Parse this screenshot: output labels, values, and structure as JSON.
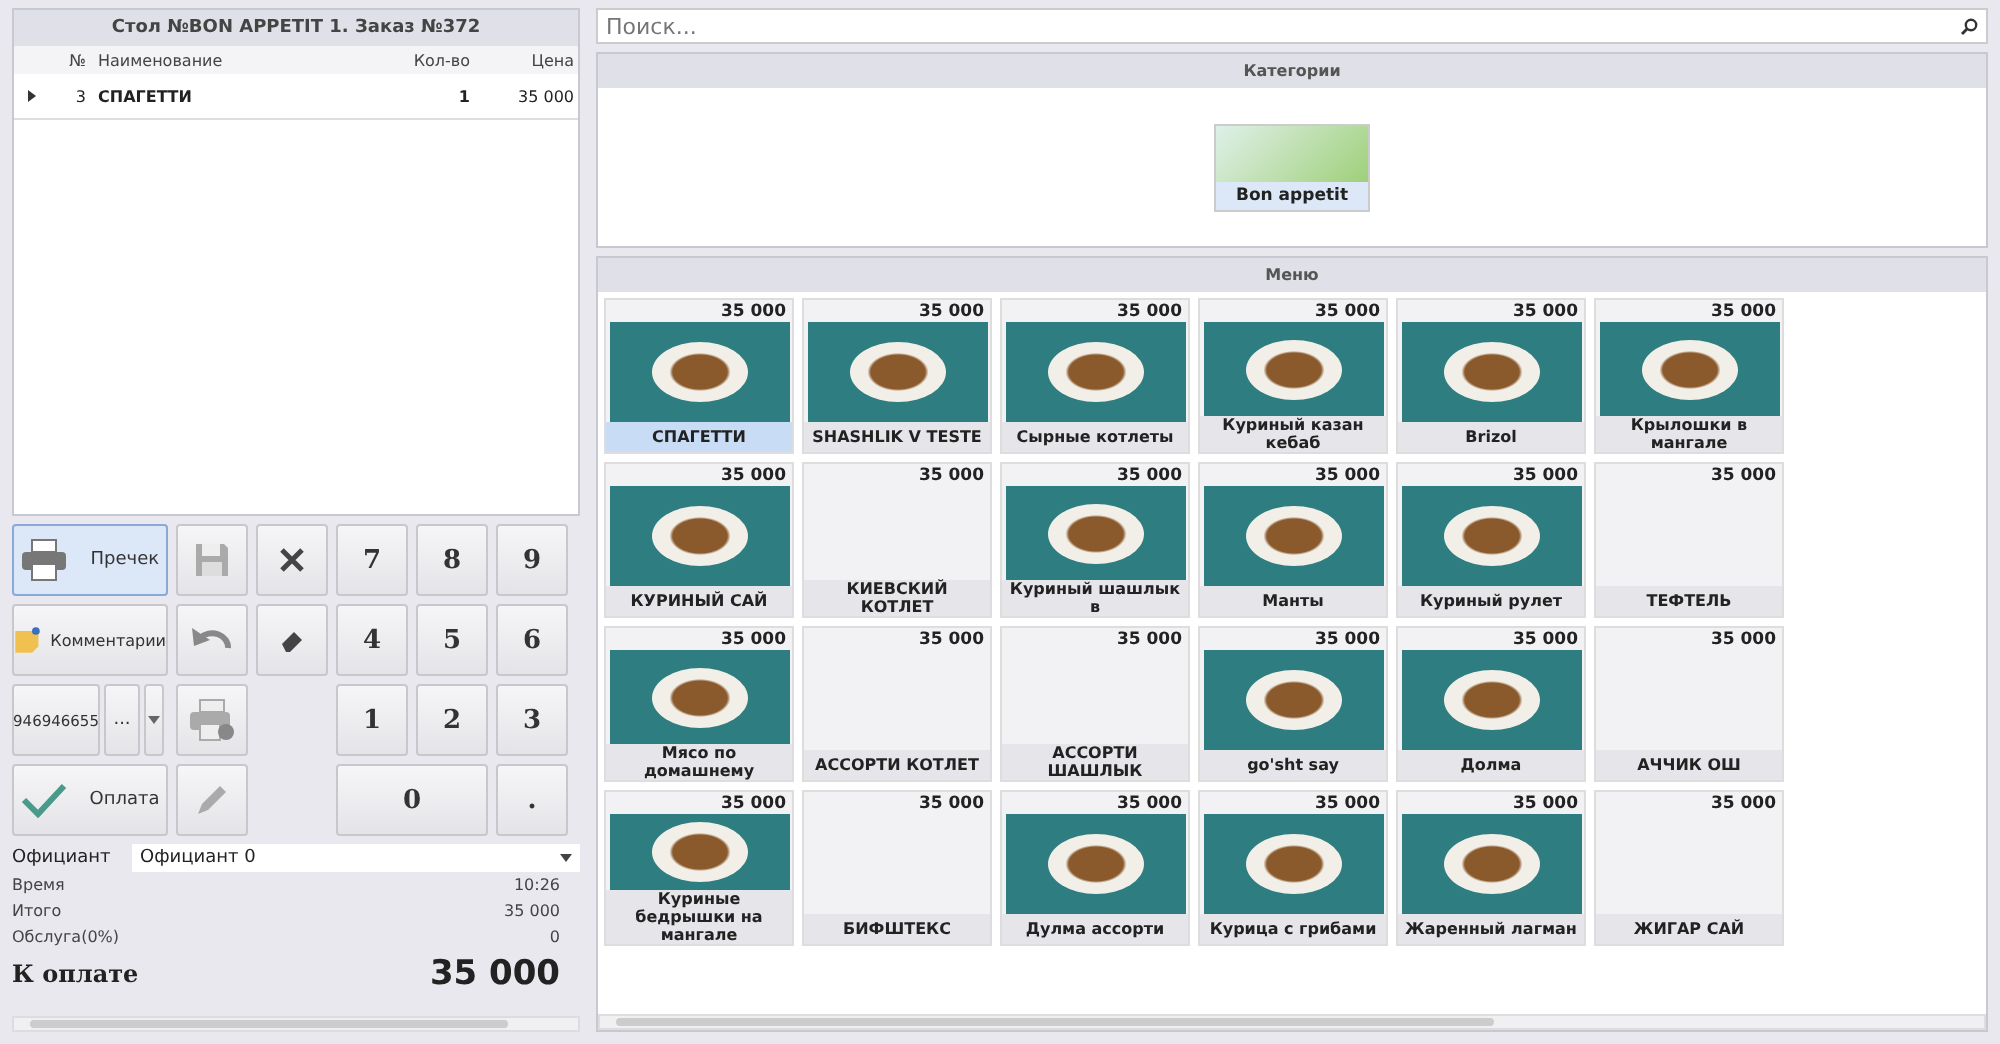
{
  "order": {
    "title": "Стол №BON APPETIT 1.  Заказ №372",
    "columns": [
      "№",
      "Наименование",
      "Кол-во",
      "Цена"
    ],
    "rows": [
      {
        "num": "3",
        "name": "СПАГЕТТИ",
        "qty": "1",
        "price": "35 000",
        "selected": true
      }
    ]
  },
  "keypad": {
    "print": "Пречек",
    "comments": "Комментарии",
    "phone": "946946655",
    "more": "...",
    "pay": "Оплата",
    "digits": [
      "7",
      "8",
      "9",
      "4",
      "5",
      "6",
      "1",
      "2",
      "3",
      "0",
      "."
    ]
  },
  "waiter": {
    "label": "Официант",
    "value": "Официант 0"
  },
  "totals": [
    {
      "label": "Время",
      "value": "10:26"
    },
    {
      "label": "Итого",
      "value": "35 000"
    },
    {
      "label": "Обслуга(0%)",
      "value": "0"
    }
  ],
  "due": {
    "label": "К оплате",
    "value": "35 000"
  },
  "search": {
    "placeholder": "Поиск..."
  },
  "categories": {
    "title": "Категории",
    "items": [
      {
        "name": "Bon appetit",
        "selected": true
      }
    ]
  },
  "menu": {
    "title": "Меню",
    "items": [
      {
        "name": "СПАГЕТТИ",
        "price": "35 000",
        "has_photo": true,
        "selected": true
      },
      {
        "name": "SHASHLIK V TESTE",
        "price": "35 000",
        "has_photo": true,
        "selected": false
      },
      {
        "name": "Сырные котлеты",
        "price": "35 000",
        "has_photo": true,
        "selected": false
      },
      {
        "name": "Куриный казан кебаб",
        "price": "35 000",
        "has_photo": true,
        "selected": false
      },
      {
        "name": "Brizol",
        "price": "35 000",
        "has_photo": true,
        "selected": false
      },
      {
        "name": "Крылошки в мангале",
        "price": "35 000",
        "has_photo": true,
        "selected": false
      },
      {
        "name": "КУРИНЫЙ САЙ",
        "price": "35 000",
        "has_photo": true,
        "selected": false
      },
      {
        "name": "КИЕВСКИЙ КОТЛЕТ",
        "price": "35 000",
        "has_photo": false,
        "selected": false
      },
      {
        "name": "Куриный шашлык в",
        "price": "35 000",
        "has_photo": true,
        "selected": false
      },
      {
        "name": "Манты",
        "price": "35 000",
        "has_photo": true,
        "selected": false
      },
      {
        "name": "Куриный рулет",
        "price": "35 000",
        "has_photo": true,
        "selected": false
      },
      {
        "name": "ТЕФТЕЛЬ",
        "price": "35 000",
        "has_photo": false,
        "selected": false
      },
      {
        "name": "Мясо по домашнему",
        "price": "35 000",
        "has_photo": true,
        "selected": false
      },
      {
        "name": "АССОРТИ КОТЛЕТ",
        "price": "35 000",
        "has_photo": false,
        "selected": false
      },
      {
        "name": "АССОРТИ ШАШЛЫК",
        "price": "35 000",
        "has_photo": false,
        "selected": false
      },
      {
        "name": "go'sht say",
        "price": "35 000",
        "has_photo": true,
        "selected": false
      },
      {
        "name": "Долма",
        "price": "35 000",
        "has_photo": true,
        "selected": false
      },
      {
        "name": "АЧЧИК ОШ",
        "price": "35 000",
        "has_photo": false,
        "selected": false
      },
      {
        "name": "Куриные бедрышки на мангале",
        "price": "35 000",
        "has_photo": true,
        "selected": false
      },
      {
        "name": "БИФШТЕКС",
        "price": "35 000",
        "has_photo": false,
        "selected": false
      },
      {
        "name": "Дулма ассорти",
        "price": "35 000",
        "has_photo": true,
        "selected": false
      },
      {
        "name": "Курица с грибами",
        "price": "35 000",
        "has_photo": true,
        "selected": false
      },
      {
        "name": "Жаренный лагман",
        "price": "35 000",
        "has_photo": true,
        "selected": false
      },
      {
        "name": "ЖИГАР САЙ",
        "price": "35 000",
        "has_photo": false,
        "selected": false
      }
    ]
  }
}
